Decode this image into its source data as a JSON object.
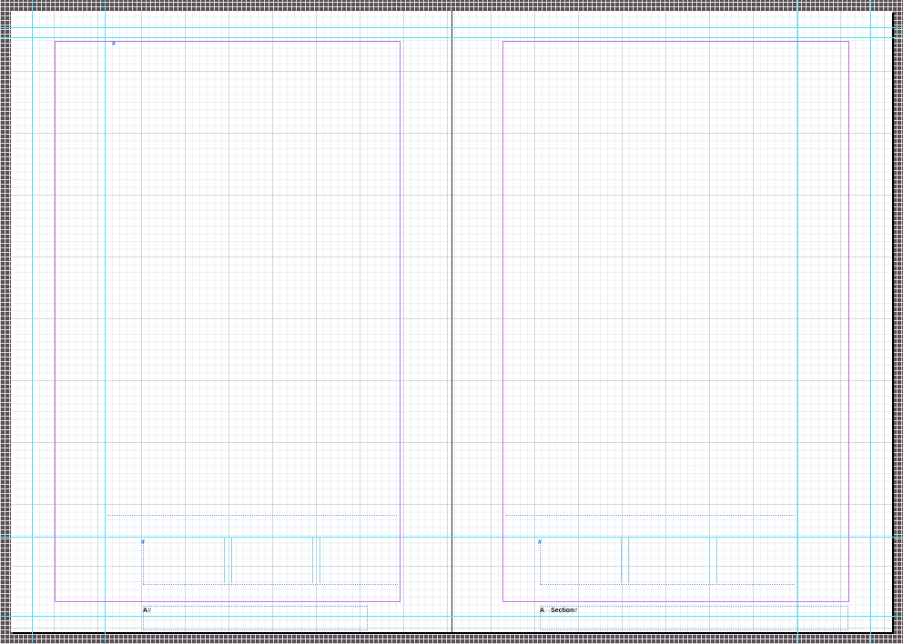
{
  "left_page": {
    "folio_prefix": "A",
    "folio_marker": "#",
    "text_frame_marker": "#",
    "caption_frame_marker": "#"
  },
  "right_page": {
    "folio_prefix": "A",
    "folio_separator": "—",
    "folio_section": "Section",
    "folio_marker": "#",
    "caption_frame_marker": "#"
  },
  "colors": {
    "pasteboard": "#5b5458",
    "guide": "#56e7f0",
    "margin": "#cf78e6",
    "frame_edge": "#7fa8d8",
    "page": "#ffffff"
  }
}
